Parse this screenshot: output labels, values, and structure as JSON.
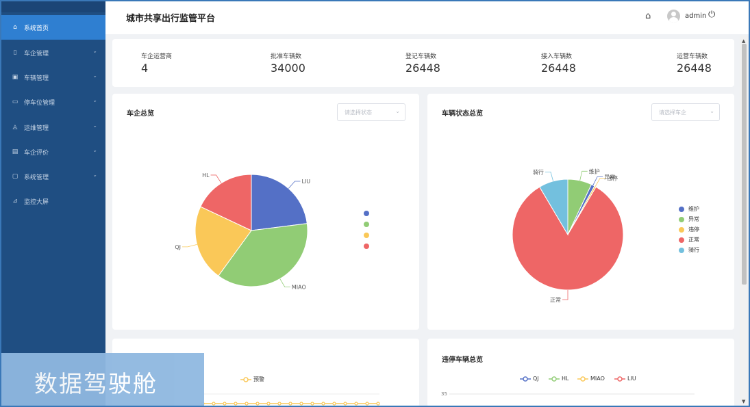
{
  "sidebar": {
    "items": [
      {
        "label": "系统首页",
        "icon": "home-icon",
        "active": true
      },
      {
        "label": "车企管理",
        "icon": "document-icon"
      },
      {
        "label": "车辆管理",
        "icon": "car-icon"
      },
      {
        "label": "停车位管理",
        "icon": "parking-icon"
      },
      {
        "label": "运维管理",
        "icon": "wrench-icon"
      },
      {
        "label": "车企评价",
        "icon": "rating-icon"
      },
      {
        "label": "系统管理",
        "icon": "settings-icon"
      },
      {
        "label": "监控大屏",
        "icon": "monitor-icon"
      }
    ]
  },
  "header": {
    "title": "城市共享出行监管平台",
    "username": "admin"
  },
  "stats": [
    {
      "label": "车企运营商",
      "value": "4"
    },
    {
      "label": "批准车辆数",
      "value": "34000"
    },
    {
      "label": "登记车辆数",
      "value": "26448"
    },
    {
      "label": "接入车辆数",
      "value": "26448"
    },
    {
      "label": "运营车辆数",
      "value": "26448"
    }
  ],
  "company_card": {
    "title": "车企总览",
    "select_placeholder": "请选择状态"
  },
  "status_card": {
    "title": "车辆状态总览",
    "select_placeholder": "请选择车企"
  },
  "violation_card": {
    "title": "违停车辆总览",
    "legend": [
      "QJ",
      "HL",
      "MIAO",
      "LIU"
    ],
    "y_tick": "35"
  },
  "bottom_left_card": {
    "legend": "预警"
  },
  "overlay": {
    "text": "数据驾驶舱"
  },
  "colors": {
    "blue": "#5470c6",
    "green": "#91cc75",
    "yellow": "#fac858",
    "red": "#ee6666",
    "cyan": "#73c0de"
  },
  "chart_data": [
    {
      "type": "pie",
      "title": "车企总览",
      "categories": [
        "LIU",
        "MIAO",
        "QJ",
        "HL"
      ],
      "values": [
        23,
        37,
        22,
        18
      ],
      "colors": [
        "#5470c6",
        "#91cc75",
        "#fac858",
        "#ee6666"
      ]
    },
    {
      "type": "pie",
      "title": "车辆状态总览",
      "categories": [
        "维护",
        "异常",
        "违停",
        "正常",
        "骑行"
      ],
      "values": [
        7,
        1,
        0.5,
        83,
        8.5
      ],
      "colors": [
        "#91cc75",
        "#5470c6",
        "#fac858",
        "#ee6666",
        "#73c0de"
      ],
      "legend": [
        "维护",
        "异常",
        "违停",
        "正常",
        "骑行"
      ],
      "legend_colors": [
        "#5470c6",
        "#91cc75",
        "#fac858",
        "#ee6666",
        "#73c0de"
      ]
    }
  ]
}
